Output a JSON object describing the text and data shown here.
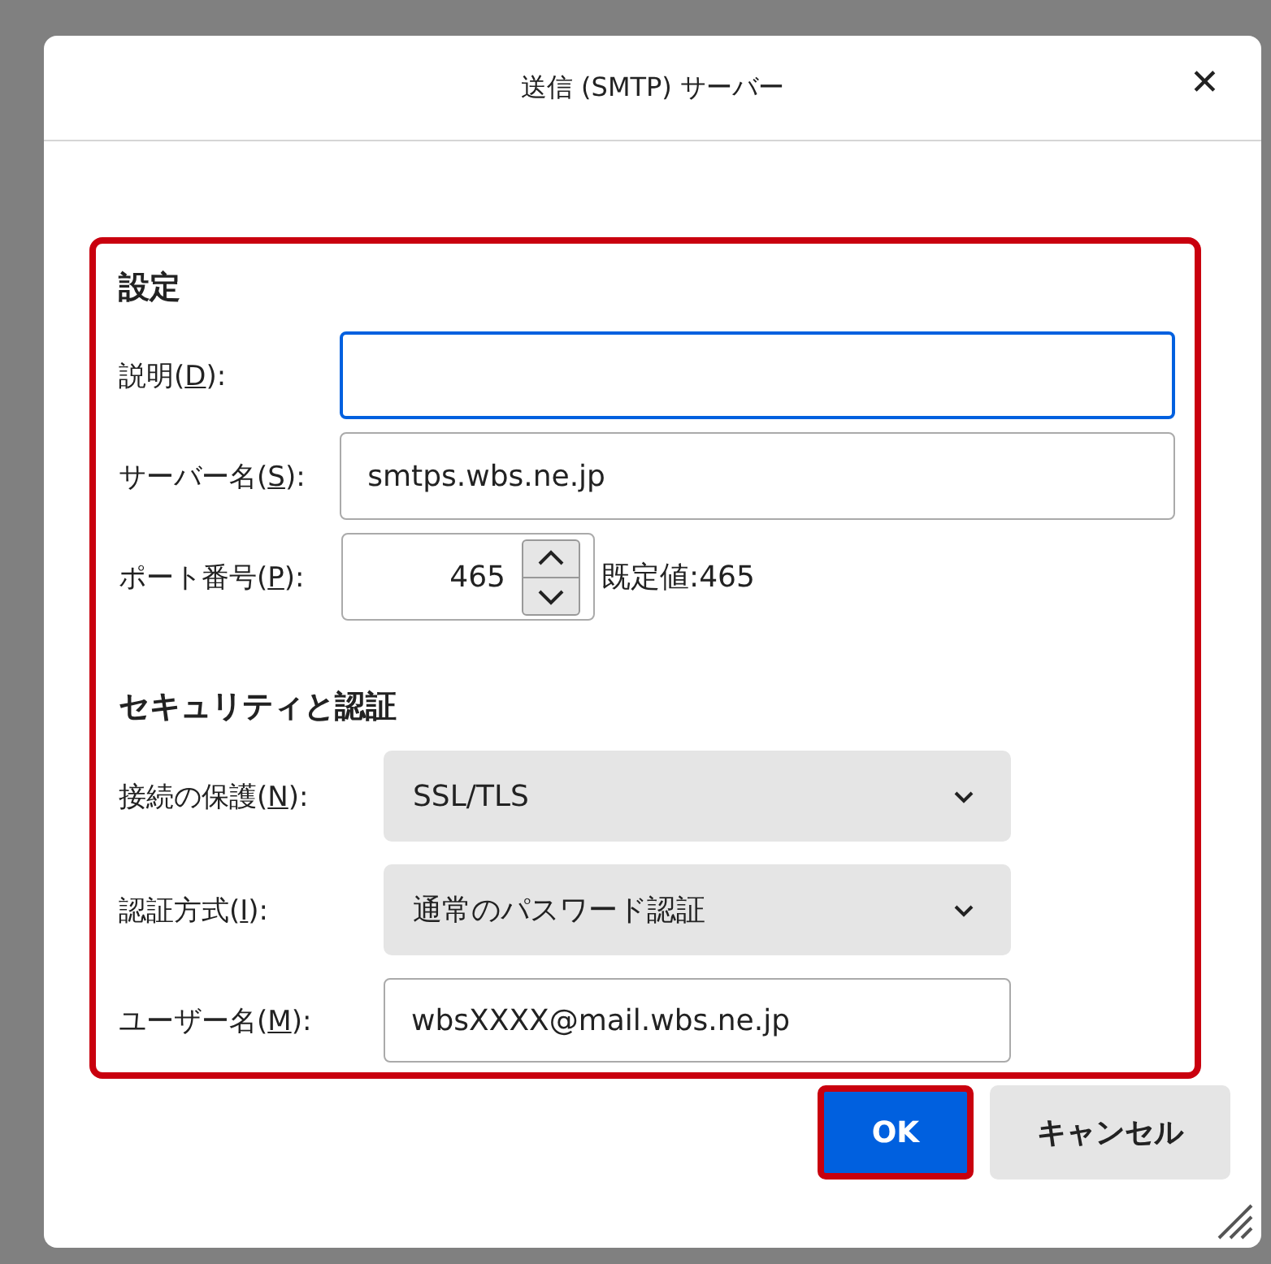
{
  "window": {
    "title": "送信 (SMTP) サーバー",
    "close": "✕"
  },
  "settings_panel": {
    "highlighted": true,
    "settings_heading": "設定",
    "description": {
      "label_before": "説明(",
      "access_key": "D",
      "label_after": "):",
      "focused": true
    },
    "server_name": {
      "label_before": "サーバー名(",
      "access_key": "S",
      "label_after": "):",
      "value": "smtps.wbs.ne.jp"
    },
    "port": {
      "label_before": "ポート番号(",
      "access_key": "P",
      "label_after": "):",
      "value": "465",
      "default_note": "既定値:465"
    },
    "security_heading": "セキュリティと認証",
    "connection_security": {
      "label_before": "接続の保護(",
      "access_key": "N",
      "label_after": "):",
      "value": "SSL/TLS"
    },
    "auth_method": {
      "label_before": "認証方式(",
      "access_key": "I",
      "label_after": "):",
      "value": "通常のパスワード認証"
    },
    "username": {
      "label_before": "ユーザー名(",
      "access_key": "M",
      "label_after": "):",
      "value": "wbsXXXX@mail.wbs.ne.jp"
    }
  },
  "buttons": [
    {
      "label": "OK",
      "kind": "primary",
      "highlighted": true
    },
    {
      "label": "キャンセル",
      "kind": "secondary",
      "highlighted": false
    }
  ]
}
